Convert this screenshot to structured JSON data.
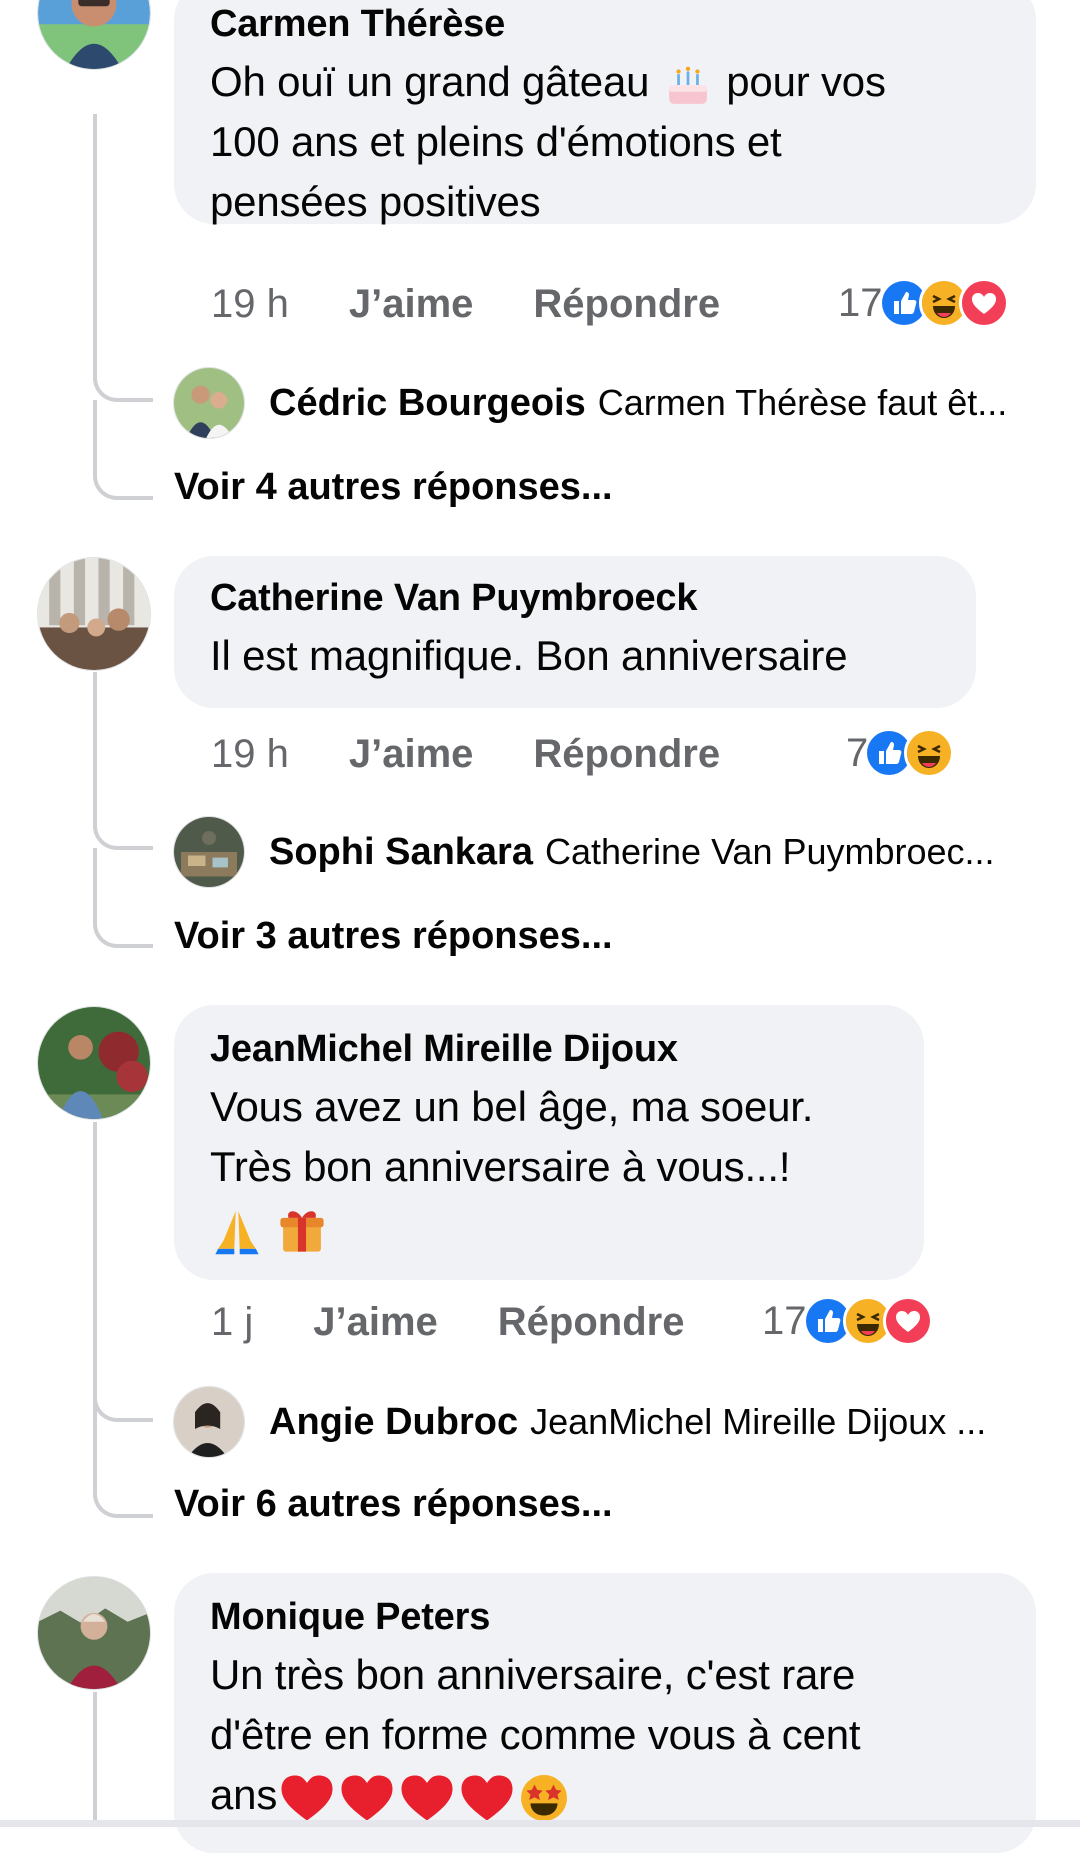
{
  "comments": [
    {
      "author": "Carmen Thérèse",
      "text_a": "Oh ouï un grand gâteau",
      "text_b": " pour vos",
      "text_line2": "100 ans et pleins d'émotions et",
      "text_line3": "pensées positives",
      "time": "19 h",
      "like": "J’aime",
      "reply": "Répondre",
      "reaction_count": "17",
      "reply_preview": {
        "name": "Cédric Bourgeois",
        "text": "Carmen Thérèse faut êt..."
      },
      "more": "Voir 4 autres réponses..."
    },
    {
      "author": "Catherine Van Puymbroeck",
      "text_line1": "Il est magnifique. Bon anniversaire",
      "time": "19 h",
      "like": "J’aime",
      "reply": "Répondre",
      "reaction_count": "7",
      "reply_preview": {
        "name": "Sophi Sankara",
        "text": "Catherine Van Puymbroec..."
      },
      "more": "Voir 3 autres réponses..."
    },
    {
      "author": "JeanMichel Mireille Dijoux",
      "text_line1": "Vous avez un bel âge, ma soeur.",
      "text_line2": "Très bon anniversaire à vous...!",
      "time": "1 j",
      "like": "J’aime",
      "reply": "Répondre",
      "reaction_count": "17",
      "reply_preview": {
        "name": "Angie Dubroc",
        "text": "JeanMichel Mireille Dijoux ..."
      },
      "more": "Voir 6 autres réponses..."
    },
    {
      "author": "Monique Peters",
      "text_line1": "Un très bon anniversaire, c'est rare",
      "text_line2": "d'être en forme comme vous  à cent",
      "text_line3": "ans"
    }
  ],
  "colors": {
    "bubble": "#f0f2f5",
    "meta_text": "#65676b",
    "like_blue": "#1877f2",
    "love_red": "#f33e58",
    "haha_yellow": "#f7b125"
  }
}
